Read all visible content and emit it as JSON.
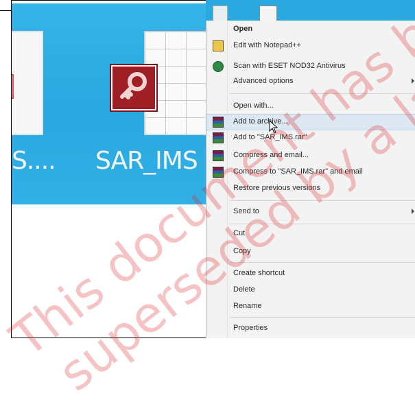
{
  "desktop": {
    "file_left_label": "S....",
    "file_right_label": "SAR_IMS"
  },
  "context_menu": {
    "items": [
      {
        "label": "Open",
        "bold": true,
        "icon": ""
      },
      {
        "label": "Edit with Notepad++",
        "icon": "notepad-icon"
      },
      {
        "label": "Scan with ESET NOD32 Antivirus",
        "icon": "eset-icon"
      },
      {
        "label": "Advanced options",
        "submenu": true
      },
      {
        "label": "Open with..."
      },
      {
        "label": "Add to archive...",
        "icon": "winrar-icon",
        "highlighted": true
      },
      {
        "label": "Add to \"SAR_IMS.rar\"",
        "icon": "winrar-icon"
      },
      {
        "label": "Compress and email...",
        "icon": "winrar-icon"
      },
      {
        "label": "Compress to \"SAR_IMS.rar\" and email",
        "icon": "winrar-icon"
      },
      {
        "label": "Restore previous versions"
      },
      {
        "label": "Send to",
        "submenu": true
      },
      {
        "label": "Cut"
      },
      {
        "label": "Copy"
      },
      {
        "label": "Create shortcut"
      },
      {
        "label": "Delete"
      },
      {
        "label": "Rename"
      },
      {
        "label": "Properties"
      }
    ]
  },
  "watermark": {
    "line1": "This document has been",
    "line2": "superseded by a later version"
  }
}
